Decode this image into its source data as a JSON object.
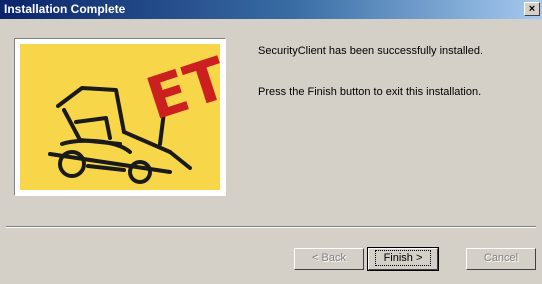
{
  "window": {
    "title": "Installation Complete",
    "close_glyph": "×"
  },
  "logo": {
    "icon": "forklift-et-logo",
    "text": "ET",
    "background_color": "#f7d64a",
    "accent_color": "#cc1f1f"
  },
  "messages": {
    "line1": "SecurityClient has been successfully installed.",
    "line2": "Press the Finish button to exit this installation."
  },
  "buttons": {
    "back": "< Back",
    "finish": "Finish >",
    "cancel": "Cancel"
  }
}
